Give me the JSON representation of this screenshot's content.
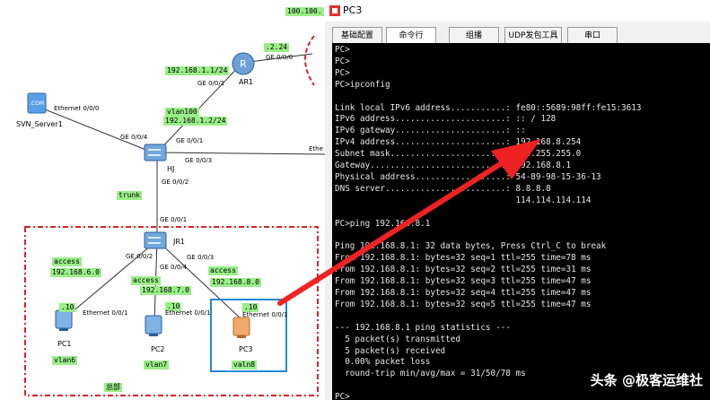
{
  "colors": {
    "label_bg": "#99ee88",
    "dashed_box": "#dd2222",
    "pc3_box": "#1e8ad6",
    "arrow": "#ee2222",
    "console_bg": "#000000"
  },
  "topology": {
    "labels": {
      "net_top": "100.100.",
      "port_top": ".2.24",
      "ar1_ip": "192.168.1.1/24",
      "vlan100": "vlan100",
      "vlan100_ip": "192.168.1.2/24",
      "trunk": "trunk",
      "access_left": "access",
      "net6": "192.168.6.0",
      "access_mid": "access",
      "net7": "192.168.7.0",
      "access_right": "access",
      "net8": "192.168.8.0",
      "pc1_ip": ".10",
      "pc2_ip": ".10",
      "pc3_ip": ".10"
    },
    "ports": {
      "ar1_ge000": "GE 0/0/0",
      "ar1_ge001": "GE 0/0/1",
      "svn_eth": "Ethernet 0/0/0",
      "hj_ge004": "GE 0/0/4",
      "hj_ge001": "GE 0/0/1",
      "hj_ge003": "GE 0/0/3",
      "hj_ge002": "GE 0/0/2",
      "jr1_ge001": "GE 0/0/1",
      "jr1_ge002": "GE 0/0/2",
      "jr1_ge004": "GE 0/0/4",
      "jr1_ge003": "GE 0/0/3",
      "pc1_eth": "Ethernet 0/0/1",
      "pc2_eth": "Ethernet 0/0/1",
      "pc3_eth": "Ethernet 0/0/1",
      "ethe_right": "Ethe"
    },
    "devices": {
      "ar1": "AR1",
      "svn": "SVN_Server1",
      "hj": "HJ",
      "jr1": "JR1",
      "pc1": "PC1",
      "pc2": "PC2",
      "pc3": "PC3",
      "vlan6": "vlan6",
      "vlan7": "vlan7",
      "vlan8": "valn8",
      "zone": "总部"
    },
    "icons": {
      "router": "router-icon",
      "switch": "switch-icon",
      "server": "server-icon",
      "pc": "pc-icon"
    }
  },
  "window": {
    "title": "PC3",
    "tabs": [
      "基础配置",
      "命令行",
      "组播",
      "UDP发包工具",
      "串口"
    ],
    "active_tab": "命令行",
    "console_lines": [
      "PC>",
      "PC>",
      "PC>",
      "PC>ipconfig",
      "",
      "Link local IPv6 address...........: fe80::5689:98ff:fe15:3613",
      "IPv6 address......................: :: / 128",
      "IPv6 gateway......................: ::",
      "IPv4 address......................: 192.168.8.254",
      "Subnet mask.......................: 255.255.255.0",
      "Gateway...........................: 192.168.8.1",
      "Physical address..................: 54-89-98-15-36-13",
      "DNS server........................: 8.8.8.8",
      "                                    114.114.114.114",
      "",
      "PC>ping 192.168.8.1",
      "",
      "Ping 192.168.8.1: 32 data bytes, Press Ctrl_C to break",
      "From 192.168.8.1: bytes=32 seq=1 ttl=255 time=78 ms",
      "From 192.168.8.1: bytes=32 seq=2 ttl=255 time=31 ms",
      "From 192.168.8.1: bytes=32 seq=3 ttl=255 time=47 ms",
      "From 192.168.8.1: bytes=32 seq=4 ttl=255 time=47 ms",
      "From 192.168.8.1: bytes=32 seq=5 ttl=255 time=47 ms",
      "",
      "--- 192.168.8.1 ping statistics ---",
      "  5 packet(s) transmitted",
      "  5 packet(s) received",
      "  0.00% packet loss",
      "  round-trip min/avg/max = 31/50/78 ms",
      "",
      "PC>"
    ]
  },
  "watermark": "头条 @极客运维社"
}
